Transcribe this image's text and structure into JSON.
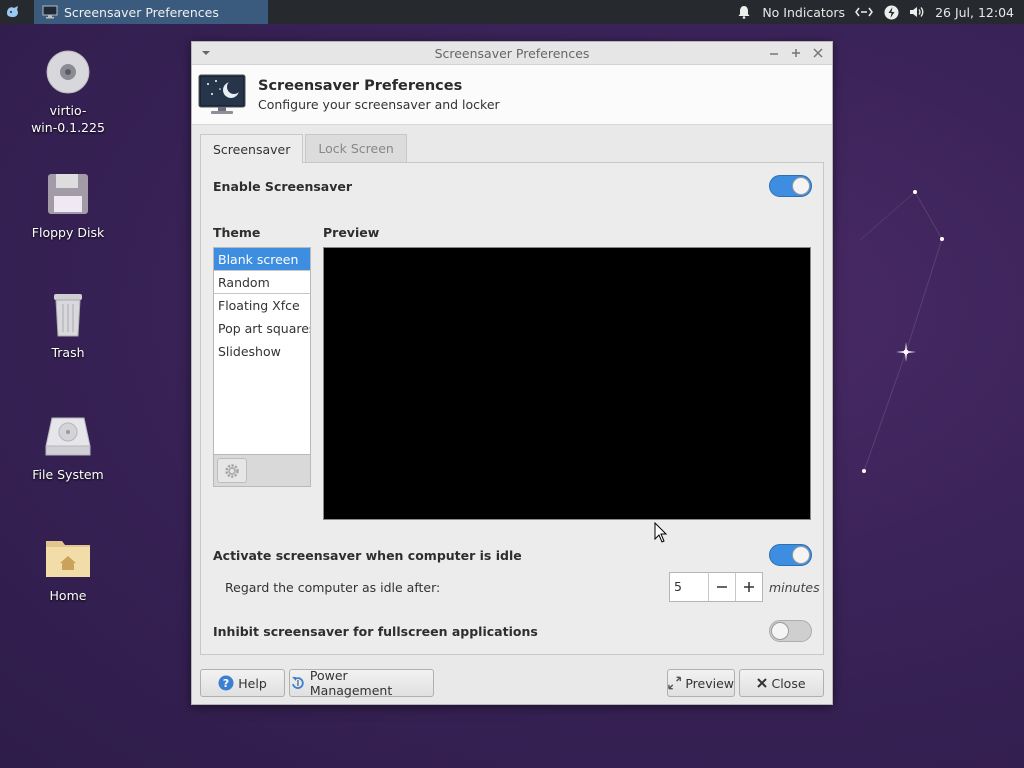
{
  "panel": {
    "task_title": "Screensaver Preferences",
    "indicators": "No Indicators",
    "clock": "26 Jul, 12:04"
  },
  "desktop": {
    "icons": [
      {
        "label": "virtio-\nwin-0.1.225",
        "icon": "disc-icon"
      },
      {
        "label": "Floppy Disk",
        "icon": "floppy-icon"
      },
      {
        "label": "Trash",
        "icon": "trash-icon"
      },
      {
        "label": "File System",
        "icon": "drive-icon"
      },
      {
        "label": "Home",
        "icon": "home-folder-icon"
      }
    ]
  },
  "window": {
    "title": "Screensaver Preferences",
    "header_title": "Screensaver Preferences",
    "header_subtitle": "Configure your screensaver and locker",
    "tabs": [
      {
        "label": "Screensaver",
        "active": true
      },
      {
        "label": "Lock Screen",
        "active": false
      }
    ],
    "enable_label": "Enable Screensaver",
    "enable_on": true,
    "theme_label": "Theme",
    "preview_label": "Preview",
    "themes": [
      "Blank screen",
      "Random",
      "Floating Xfce",
      "Pop art squares",
      "Slideshow"
    ],
    "selected_theme": "Blank screen",
    "activate_label": "Activate screensaver when computer is idle",
    "activate_on": true,
    "idle_label": "Regard the computer as idle after:",
    "idle_value": "5",
    "idle_unit": "minutes",
    "inhibit_label": "Inhibit screensaver for fullscreen applications",
    "inhibit_on": false,
    "buttons": {
      "help": "Help",
      "power": "Power Management",
      "preview": "Preview",
      "close": "Close"
    }
  },
  "colors": {
    "accent": "#3d8ee0",
    "panel": "#262a2e",
    "desktop": "#3a2358"
  }
}
